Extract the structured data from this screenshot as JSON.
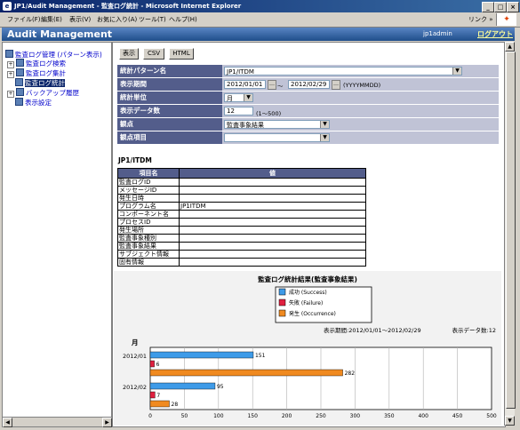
{
  "window": {
    "title": "JP1/Audit Management - 監査ログ統計 - Microsoft Internet Explorer",
    "controls": [
      "_",
      "□",
      "×"
    ]
  },
  "menu": {
    "items": [
      "ファイル(F)",
      "編集(E)",
      "表示(V)",
      "お気に入り(A)",
      "ツール(T)",
      "ヘルプ(H)"
    ],
    "links": "リンク »"
  },
  "header": {
    "title": "Audit Management",
    "user": "jp1admin",
    "logout": "ログアウト"
  },
  "tree": {
    "root": "監査ログ管理 (パターン表示)",
    "items": [
      {
        "label": "監査ログ検索",
        "expander": "+"
      },
      {
        "label": "監査ログ集計",
        "expander": "+"
      },
      {
        "label": "監査ログ統計",
        "expander": "",
        "selected": true
      },
      {
        "label": "バックアップ履歴",
        "expander": "+"
      },
      {
        "label": "表示設定",
        "expander": ""
      }
    ]
  },
  "toolbar": {
    "display": "表示",
    "csv": "CSV",
    "html": "HTML"
  },
  "form": {
    "pattern_label": "統計パターン名",
    "pattern_value": "JP1/ITDM",
    "period_label": "表示期間",
    "period_from": "2012/01/01",
    "period_sep": "〜",
    "period_to": "2012/02/29",
    "period_hint": "(YYYYMMDD)",
    "unit_label": "統計単位",
    "unit_value": "月",
    "count_label": "表示データ数",
    "count_value": "12",
    "count_hint": "(1〜500)",
    "viewpoint_label": "観点",
    "viewpoint_value": "監査事象結果",
    "vitem_label": "観点項目",
    "vitem_value": ""
  },
  "items_table": {
    "title": "JP1/ITDM",
    "col_name": "項目名",
    "col_value": "値",
    "rows": [
      {
        "name": "監査ログID",
        "value": ""
      },
      {
        "name": "メッセージID",
        "value": ""
      },
      {
        "name": "発生日時",
        "value": ""
      },
      {
        "name": "プログラム名",
        "value": "JP1ITDM"
      },
      {
        "name": "コンポーネント名",
        "value": ""
      },
      {
        "name": "プロセスID",
        "value": ""
      },
      {
        "name": "発生場所",
        "value": ""
      },
      {
        "name": "監査事象種別",
        "value": ""
      },
      {
        "name": "監査事象結果",
        "value": ""
      },
      {
        "name": "サブジェクト情報",
        "value": ""
      },
      {
        "name": "固有情報",
        "value": ""
      }
    ]
  },
  "colors": {
    "success": "#3e9be8",
    "failure": "#e02040",
    "occurrence": "#f08a20"
  },
  "chart_data": {
    "type": "bar",
    "orientation": "horizontal",
    "title": "監査ログ統計結果(監査事象結果)",
    "period_text": "表示期間:2012/01/01〜2012/02/29",
    "count_text": "表示データ数:12",
    "ylabel": "月",
    "categories": [
      "2012/01",
      "2012/02"
    ],
    "series": [
      {
        "name": "成功 (Success)",
        "values": [
          151,
          95
        ]
      },
      {
        "name": "失敗 (Failure)",
        "values": [
          6,
          7
        ]
      },
      {
        "name": "発生 (Occurrence)",
        "values": [
          282,
          28
        ]
      }
    ],
    "xlim": [
      0,
      500
    ],
    "xticks": [
      0,
      50,
      100,
      150,
      200,
      250,
      300,
      350,
      400,
      450,
      500
    ],
    "grid": true,
    "legend": "top-center"
  }
}
